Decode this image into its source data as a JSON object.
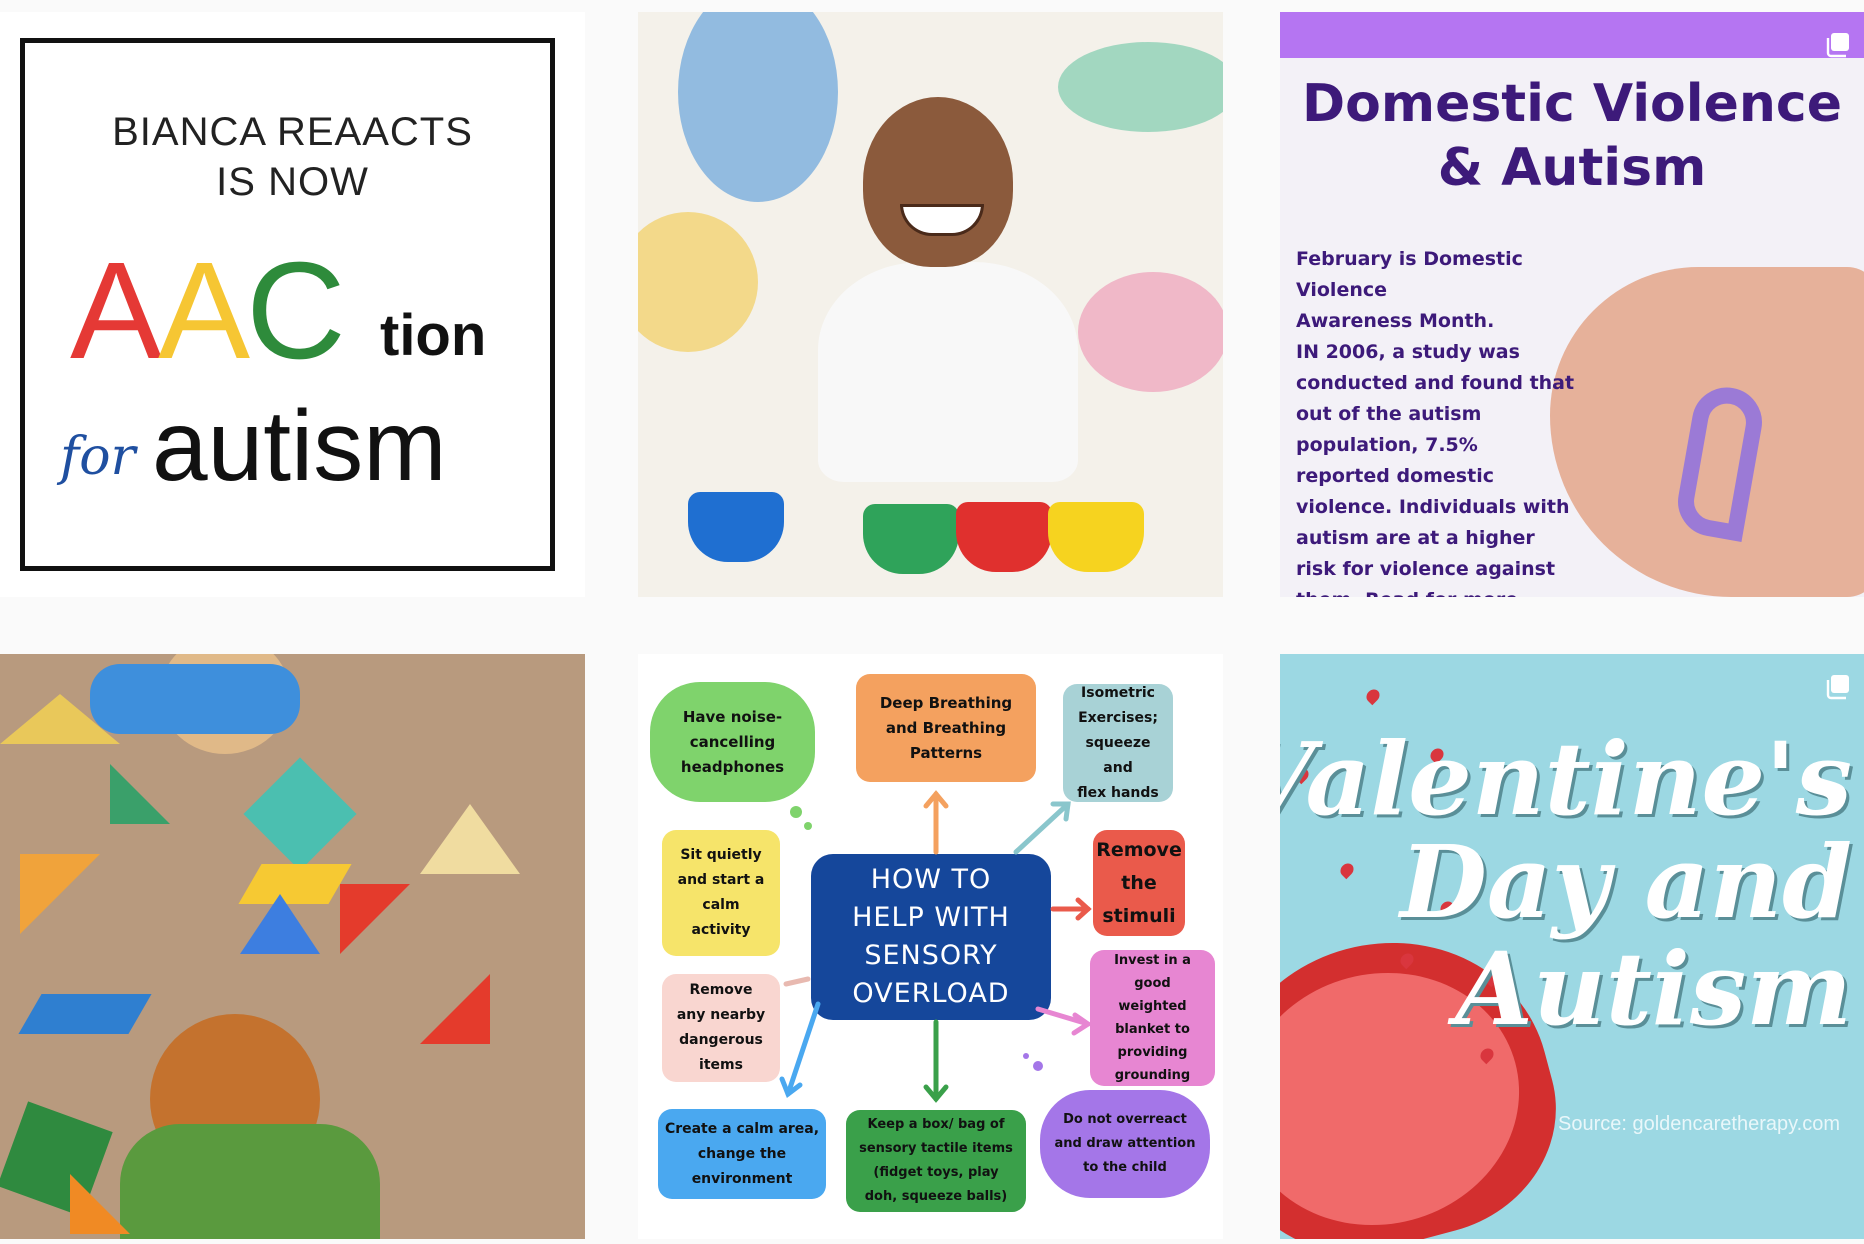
{
  "posts": [
    {
      "line1": "BIANCA REAACTS",
      "line2": "IS NOW",
      "aac_a1": "A",
      "aac_a2": "A",
      "aac_c": "C",
      "tion": "tion",
      "for": "for",
      "autism": "autism",
      "colors": {
        "red": "#e53935",
        "yellow": "#f6c633",
        "green": "#2e8b3b",
        "blue": "#1f4fa0"
      }
    },
    {
      "kind": "photo"
    },
    {
      "title": "Domestic Violence\n& Autism",
      "body": "February is Domestic Violence\nAwareness Month.\nIN 2006, a study was\nconducted and found that\nout of the autism\npopulation, 7.5%\nreported domestic\nviolence. Individuals with\nautism are at a higher\nrisk for violence against\nthem. Read for more...",
      "accent": "#b575f2",
      "text_color": "#3d1a7a",
      "icon": "multiple-posts-icon"
    },
    {
      "kind": "photo"
    },
    {
      "center": "HOW TO\nHELP WITH\nSENSORY\nOVERLOAD",
      "bubbles": [
        "Have noise-\ncancelling\nheadphones",
        "Deep Breathing\nand Breathing\nPatterns",
        "Isometric\nExercises;\nsqueeze and\nflex hands",
        "Sit quietly\nand start a\ncalm\nactivity",
        "Remove\nthe\nstimuli",
        "Remove\nany nearby\ndangerous\nitems",
        "Invest in a good\nweighted\nblanket to\nproviding\ngrounding",
        "Create a calm area,\nchange the\nenvironment",
        "Keep a box/ bag of\nsensory tactile items\n(fidget toys, play\ndoh, squeeze balls)",
        "Do not overreact\nand draw attention\nto the child"
      ]
    },
    {
      "line1": "Valentine's",
      "line2": "Day and",
      "line3": "Autism",
      "source": "Source: goldencaretherapy.com",
      "icon": "multiple-posts-icon"
    }
  ]
}
